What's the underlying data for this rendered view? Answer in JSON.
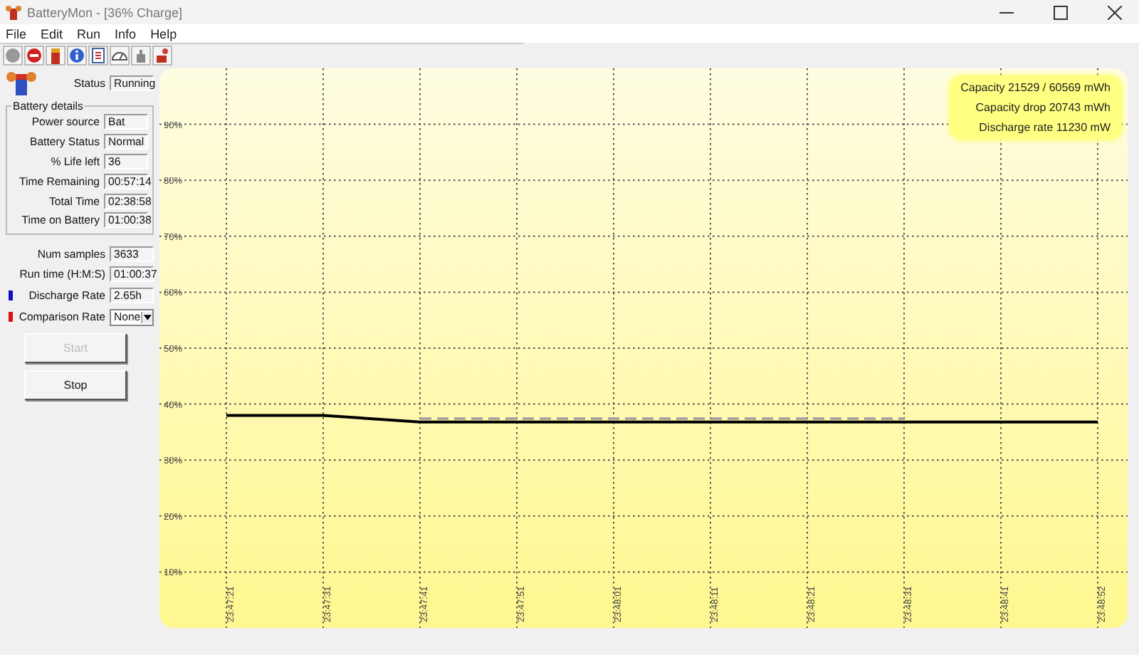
{
  "window": {
    "title": "BatteryMon - [36% Charge]"
  },
  "menu": [
    "File",
    "Edit",
    "Run",
    "Info",
    "Help"
  ],
  "status": {
    "label": "Status",
    "value": "Running"
  },
  "battery_details": {
    "title": "Battery details",
    "fields": [
      {
        "label": "Power source",
        "value": "Bat"
      },
      {
        "label": "Battery Status",
        "value": "Normal"
      },
      {
        "label": "% Life left",
        "value": "36"
      },
      {
        "label": "Time Remaining",
        "value": "00:57:14"
      },
      {
        "label": "Total Time",
        "value": "02:38:58"
      },
      {
        "label": "Time on Battery",
        "value": "01:00:38"
      }
    ]
  },
  "stats": [
    {
      "kind": "text",
      "label": "Num samples",
      "value": "3633"
    },
    {
      "kind": "text",
      "label": "Run time (H:M:S)",
      "value": "01:00:37"
    },
    {
      "kind": "text",
      "label": "Discharge Rate",
      "value": "2.65h",
      "color": "#1010c0"
    },
    {
      "kind": "dropdown",
      "label": "Comparison Rate",
      "value": "None",
      "color": "#e01010"
    }
  ],
  "buttons": [
    {
      "label": "Start",
      "disabled": true
    },
    {
      "label": "Stop",
      "disabled": false
    }
  ],
  "chart": {
    "info": [
      "Capacity 21529 / 60569 mWh",
      "Capacity drop 20743 mWh",
      "Discharge rate 11230 mW"
    ],
    "chart_data": {
      "type": "line",
      "categories": [
        "23:47:21",
        "23:47:31",
        "23:47:41",
        "23:47:51",
        "23:48:01",
        "23:48:11",
        "23:48:21",
        "23:48:31",
        "23:48:41",
        "23:48:52"
      ],
      "series": [
        {
          "color": "#000000",
          "line_style": "solid",
          "values": [
            38,
            38,
            36.8,
            36.8,
            36.8,
            36.8,
            36.8,
            36.8,
            36.8,
            36.8
          ]
        },
        {
          "color": "#a0a0a0",
          "line_style": "dashed",
          "values": [
            null,
            null,
            37.4,
            37.4,
            37.4,
            37.4,
            37.4,
            37.4,
            null,
            null
          ]
        }
      ],
      "ylim": [
        0,
        100
      ],
      "grid": true,
      "yticks": [
        {
          "value": 10,
          "label": "10%"
        },
        {
          "value": 20,
          "label": "20%"
        },
        {
          "value": 30,
          "label": "30%"
        },
        {
          "value": 40,
          "label": "40%"
        },
        {
          "value": 50,
          "label": "50%"
        },
        {
          "value": 60,
          "label": "60%"
        },
        {
          "value": 70,
          "label": "70%"
        },
        {
          "value": 80,
          "label": "80%"
        },
        {
          "value": 90,
          "label": "90%"
        }
      ]
    }
  }
}
